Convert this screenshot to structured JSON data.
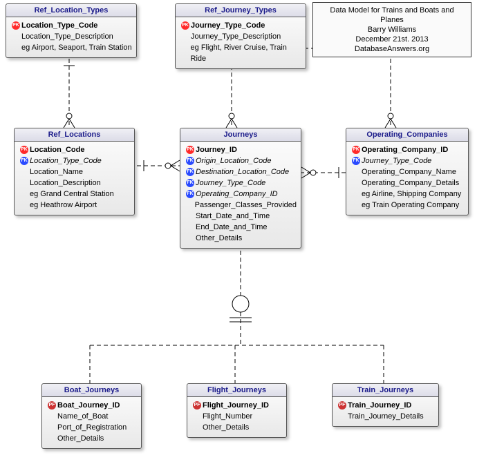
{
  "note": {
    "line1": "Data Model for Trains and Boats and Planes",
    "line2": "Barry Williams",
    "line3": "December 21st. 2013",
    "line4": "DatabaseAnswers.org"
  },
  "entities": {
    "ref_location_types": {
      "title": "Ref_Location_Types",
      "attrs": [
        {
          "key": "PK",
          "text": "Location_Type_Code",
          "bold": true
        },
        {
          "key": "",
          "text": "Location_Type_Description"
        },
        {
          "key": "",
          "text": "eg Airport, Seaport, Train Station"
        }
      ]
    },
    "ref_journey_types": {
      "title": "Ref_Journey_Types",
      "attrs": [
        {
          "key": "PK",
          "text": "Journey_Type_Code",
          "bold": true
        },
        {
          "key": "",
          "text": "Journey_Type_Description"
        },
        {
          "key": "",
          "text": "eg Flight, River Cruise, Train Ride"
        }
      ]
    },
    "ref_locations": {
      "title": "Ref_Locations",
      "attrs": [
        {
          "key": "PK",
          "text": "Location_Code",
          "bold": true
        },
        {
          "key": "FK",
          "text": "Location_Type_Code",
          "italic": true
        },
        {
          "key": "",
          "text": "Location_Name"
        },
        {
          "key": "",
          "text": "Location_Description"
        },
        {
          "key": "",
          "text": "eg Grand Central Station"
        },
        {
          "key": "",
          "text": "eg Heathrow Airport"
        }
      ]
    },
    "journeys": {
      "title": "Journeys",
      "attrs": [
        {
          "key": "PK",
          "text": "Journey_ID",
          "bold": true
        },
        {
          "key": "FK",
          "text": "Origin_Location_Code",
          "italic": true
        },
        {
          "key": "FK",
          "text": "Destination_Location_Code",
          "italic": true
        },
        {
          "key": "FK",
          "text": "Journey_Type_Code",
          "italic": true
        },
        {
          "key": "FK",
          "text": "Operating_Company_ID",
          "italic": true
        },
        {
          "key": "",
          "text": "Passenger_Classes_Provided"
        },
        {
          "key": "",
          "text": "Start_Date_and_Time"
        },
        {
          "key": "",
          "text": "End_Date_and_Time"
        },
        {
          "key": "",
          "text": "Other_Details"
        }
      ]
    },
    "operating_companies": {
      "title": "Operating_Companies",
      "attrs": [
        {
          "key": "PK",
          "text": "Operating_Company_ID",
          "bold": true
        },
        {
          "key": "FK",
          "text": "Journey_Type_Code",
          "italic": true
        },
        {
          "key": "",
          "text": "Operating_Company_Name"
        },
        {
          "key": "",
          "text": "Operating_Company_Details"
        },
        {
          "key": "",
          "text": "eg Airline, Shipping Company"
        },
        {
          "key": "",
          "text": "eg Train Operating Company"
        }
      ]
    },
    "boat_journeys": {
      "title": "Boat_Journeys",
      "attrs": [
        {
          "key": "PF",
          "text": "Boat_Journey_ID",
          "bold": true
        },
        {
          "key": "",
          "text": "Name_of_Boat"
        },
        {
          "key": "",
          "text": "Port_of_Registration"
        },
        {
          "key": "",
          "text": "Other_Details"
        }
      ]
    },
    "flight_journeys": {
      "title": "Flight_Journeys",
      "attrs": [
        {
          "key": "PF",
          "text": "Flight_Journey_ID",
          "bold": true
        },
        {
          "key": "",
          "text": "Flight_Number"
        },
        {
          "key": "",
          "text": "Other_Details"
        }
      ]
    },
    "train_journeys": {
      "title": "Train_Journeys",
      "attrs": [
        {
          "key": "PF",
          "text": "Train_Journey_ID",
          "bold": true
        },
        {
          "key": "",
          "text": "Train_Journey_Details"
        }
      ]
    }
  }
}
